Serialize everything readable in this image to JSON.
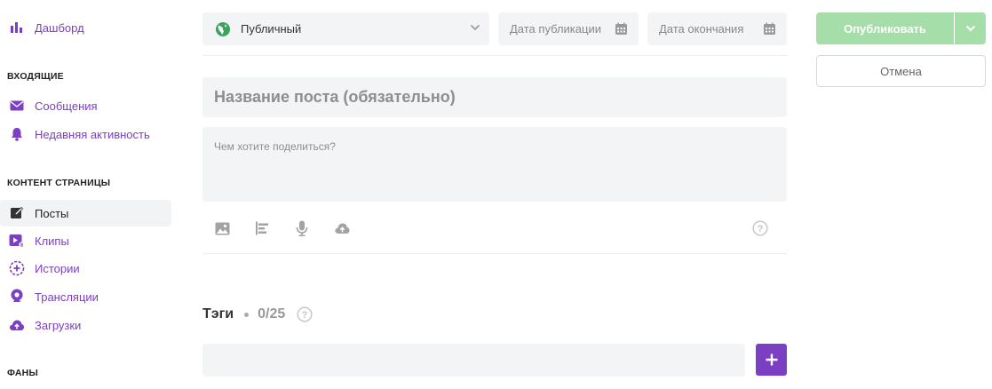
{
  "sidebar": {
    "dashboard": {
      "label": "Дашборд"
    },
    "inbox": {
      "heading": "ВХОДЯЩИЕ",
      "items": [
        {
          "label": "Сообщения",
          "icon": "envelope-icon"
        },
        {
          "label": "Недавняя активность",
          "icon": "bell-icon"
        }
      ]
    },
    "content": {
      "heading": "КОНТЕНТ СТРАНИЦЫ",
      "items": [
        {
          "label": "Посты",
          "icon": "edit-icon",
          "active": true
        },
        {
          "label": "Клипы",
          "icon": "clip-icon"
        },
        {
          "label": "Истории",
          "icon": "story-icon"
        },
        {
          "label": "Трансляции",
          "icon": "broadcast-icon"
        },
        {
          "label": "Загрузки",
          "icon": "cloud-upload-icon"
        }
      ]
    },
    "fans": {
      "heading": "ФАНЫ"
    }
  },
  "editor": {
    "visibility": {
      "value": "Публичный",
      "icon": "globe-icon"
    },
    "publish_date": {
      "placeholder": "Дата публикации",
      "icon": "calendar-icon"
    },
    "end_date": {
      "placeholder": "Дата окончания",
      "icon": "calendar-icon"
    },
    "title": {
      "placeholder": "Название поста (обязательно)"
    },
    "body": {
      "placeholder": "Чем хотите поделиться?"
    },
    "toolbar": [
      "image-icon",
      "align-icon",
      "microphone-icon",
      "cloud-upload-icon"
    ],
    "help_icon": "help-icon"
  },
  "tags": {
    "label": "Тэги",
    "count": "0/25",
    "add_icon": "plus-icon"
  },
  "actions": {
    "publish": "Опубликовать",
    "cancel": "Отмена"
  },
  "colors": {
    "accent_purple": "#7b3fc4",
    "publish_green": "#a6deaa",
    "globe_green": "#3aa45f",
    "field_bg": "#f3f4f6"
  }
}
